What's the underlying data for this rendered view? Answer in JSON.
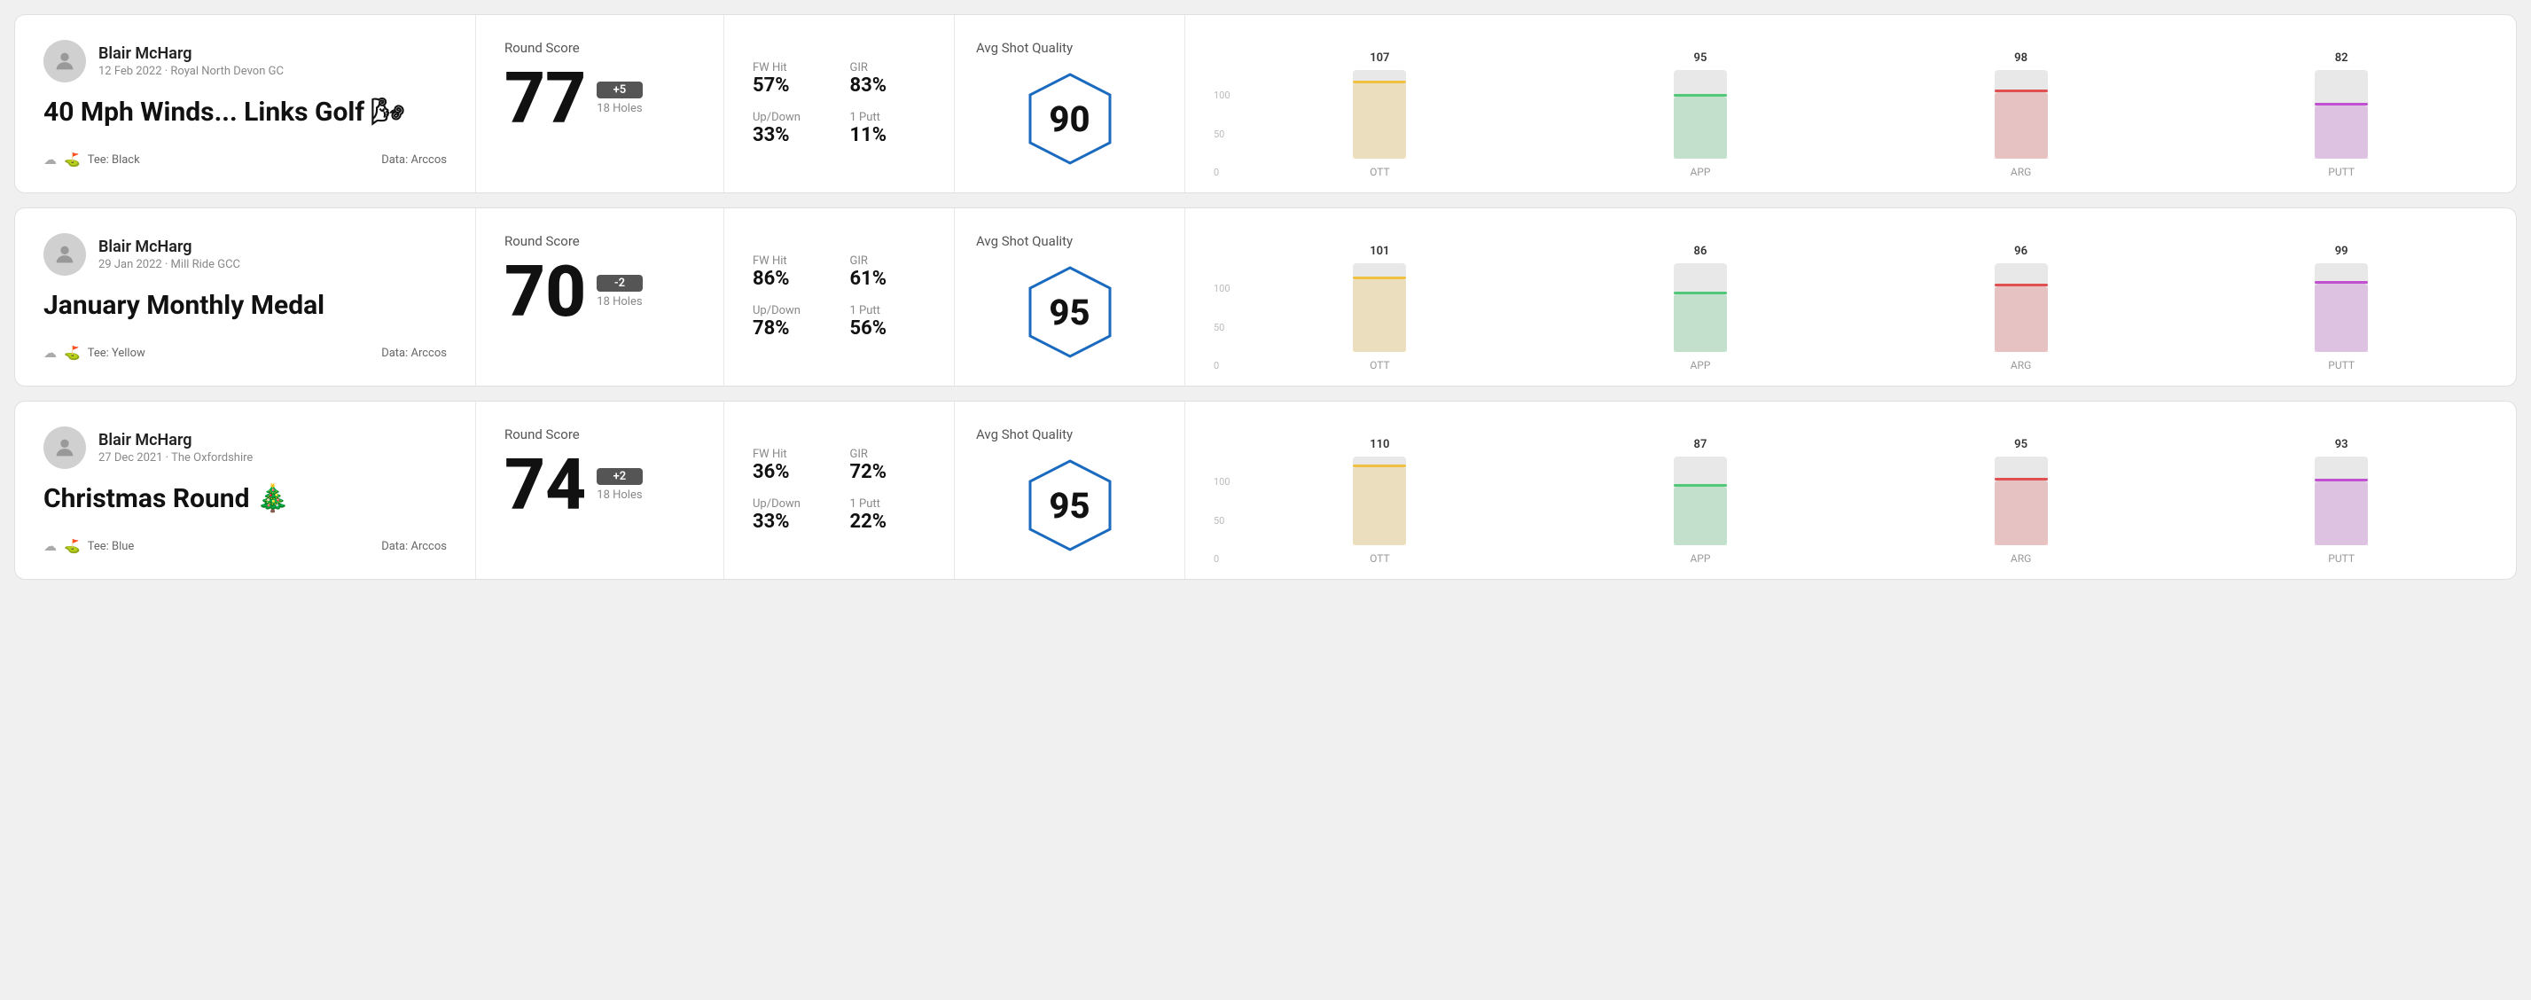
{
  "rounds": [
    {
      "id": "round-1",
      "player_name": "Blair McHarg",
      "date": "12 Feb 2022 · Royal North Devon GC",
      "title": "40 Mph Winds... Links Golf 🌬",
      "tee": "Black",
      "data_source": "Data: Arccos",
      "score": "77",
      "score_diff": "+5",
      "holes": "18 Holes",
      "fw_hit": "57%",
      "gir": "83%",
      "up_down": "33%",
      "one_putt": "11%",
      "avg_quality_label": "Avg Shot Quality",
      "avg_quality_score": "90",
      "bars": [
        {
          "label": "OTT",
          "value": 107,
          "color": "#f0c040",
          "pct": 85
        },
        {
          "label": "APP",
          "value": 95,
          "color": "#50c878",
          "pct": 70
        },
        {
          "label": "ARG",
          "value": 98,
          "color": "#e05050",
          "pct": 75
        },
        {
          "label": "PUTT",
          "value": 82,
          "color": "#c050d0",
          "pct": 60
        }
      ]
    },
    {
      "id": "round-2",
      "player_name": "Blair McHarg",
      "date": "29 Jan 2022 · Mill Ride GCC",
      "title": "January Monthly Medal",
      "tee": "Yellow",
      "data_source": "Data: Arccos",
      "score": "70",
      "score_diff": "-2",
      "holes": "18 Holes",
      "fw_hit": "86%",
      "gir": "61%",
      "up_down": "78%",
      "one_putt": "56%",
      "avg_quality_label": "Avg Shot Quality",
      "avg_quality_score": "95",
      "bars": [
        {
          "label": "OTT",
          "value": 101,
          "color": "#f0c040",
          "pct": 82
        },
        {
          "label": "APP",
          "value": 86,
          "color": "#50c878",
          "pct": 65
        },
        {
          "label": "ARG",
          "value": 96,
          "color": "#e05050",
          "pct": 74
        },
        {
          "label": "PUTT",
          "value": 99,
          "color": "#c050d0",
          "pct": 77
        }
      ]
    },
    {
      "id": "round-3",
      "player_name": "Blair McHarg",
      "date": "27 Dec 2021 · The Oxfordshire",
      "title": "Christmas Round 🎄",
      "tee": "Blue",
      "data_source": "Data: Arccos",
      "score": "74",
      "score_diff": "+2",
      "holes": "18 Holes",
      "fw_hit": "36%",
      "gir": "72%",
      "up_down": "33%",
      "one_putt": "22%",
      "avg_quality_label": "Avg Shot Quality",
      "avg_quality_score": "95",
      "bars": [
        {
          "label": "OTT",
          "value": 110,
          "color": "#f0c040",
          "pct": 88
        },
        {
          "label": "APP",
          "value": 87,
          "color": "#50c878",
          "pct": 66
        },
        {
          "label": "ARG",
          "value": 95,
          "color": "#e05050",
          "pct": 73
        },
        {
          "label": "PUTT",
          "value": 93,
          "color": "#c050d0",
          "pct": 72
        }
      ]
    }
  ],
  "y_axis_labels": [
    "100",
    "50",
    "0"
  ]
}
